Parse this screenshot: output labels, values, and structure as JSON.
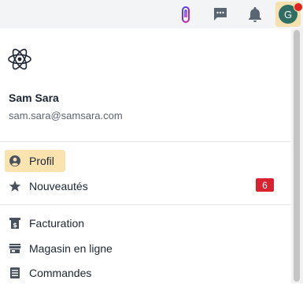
{
  "topbar": {
    "icons": [
      "paperclip-icon",
      "chat-icon",
      "bell-icon"
    ],
    "avatar": {
      "initial": "G",
      "notification": true
    }
  },
  "profile": {
    "logo": "atom-icon",
    "name": "Sam Sara",
    "email": "sam.sara@samsara.com"
  },
  "menu": {
    "group1": [
      {
        "label": "Profil",
        "icon": "user-circle-icon",
        "active": true
      },
      {
        "label": "Nouveautés",
        "icon": "star-icon",
        "badge": "6"
      }
    ],
    "group2": [
      {
        "label": "Facturation",
        "icon": "invoice-icon"
      },
      {
        "label": "Magasin en ligne",
        "icon": "store-icon"
      },
      {
        "label": "Commandes",
        "icon": "orders-icon"
      }
    ]
  },
  "colors": {
    "active_bg": "#fbe3b0",
    "badge_bg": "#d9222f",
    "avatar_bg": "#2e6e63"
  }
}
